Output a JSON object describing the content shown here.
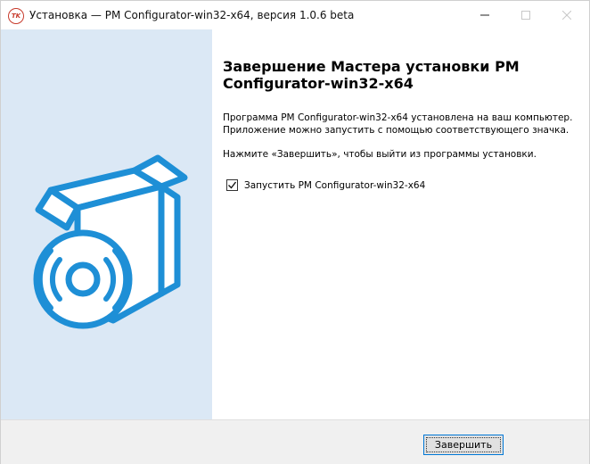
{
  "window": {
    "title": "Установка — PM Configurator-win32-x64, версия 1.0.6 beta",
    "app_icon_text": "TK"
  },
  "icons": {
    "app": "installer-app-icon",
    "minimize": "minimize-icon",
    "maximize": "maximize-icon",
    "close": "close-icon",
    "illustration": "box-with-disc-icon",
    "check": "checkmark-icon"
  },
  "content": {
    "heading": "Завершение Мастера установки PM Configurator-win32-x64",
    "paragraph1": "Программа PM Configurator-win32-x64 установлена на ваш компьютер. Приложение можно запустить с помощью соответствующего значка.",
    "paragraph2": "Нажмите «Завершить», чтобы выйти из программы установки.",
    "launch_checkbox": {
      "label": "Запустить PM Configurator-win32-x64",
      "checked": true
    }
  },
  "footer": {
    "finish_label": "Завершить"
  },
  "colors": {
    "side_panel": "#dbe8f5",
    "illustration": "#1e8fd6",
    "footer": "#f0f0f0",
    "button_focus_border": "#0078d7"
  }
}
